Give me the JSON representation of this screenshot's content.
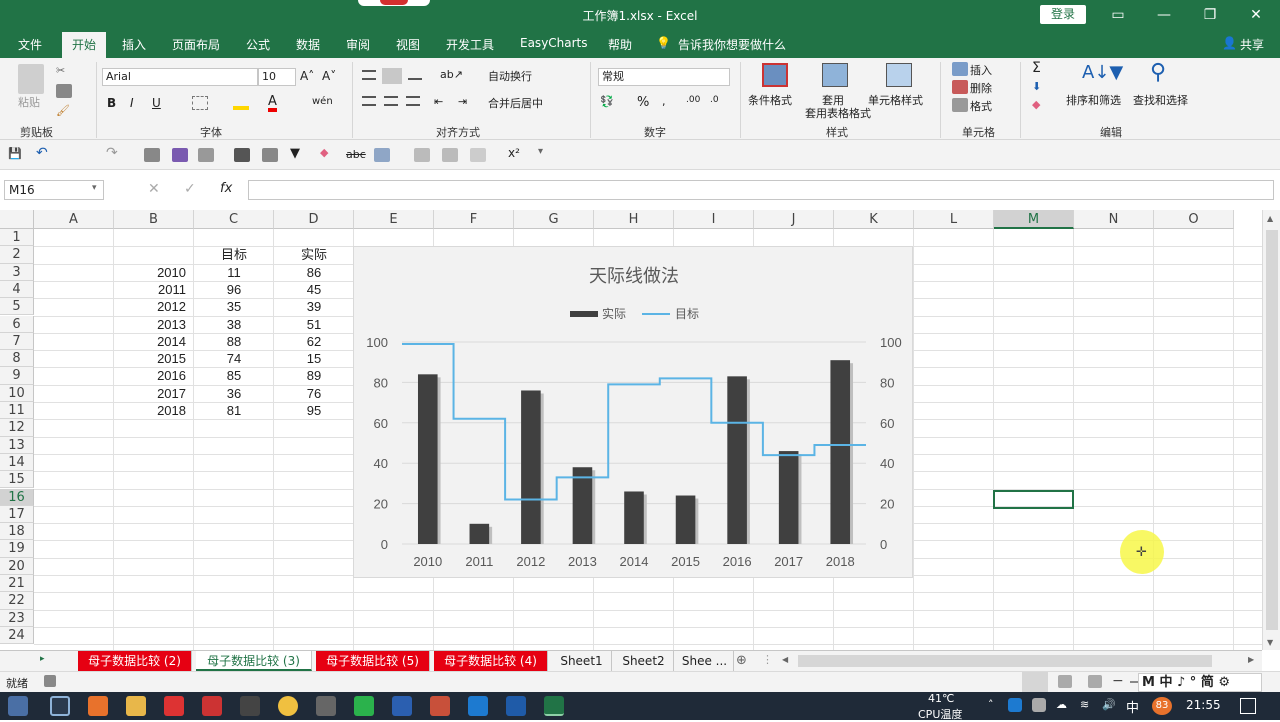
{
  "app": {
    "title": "工作簿1.xlsx  -  Excel",
    "login": "登录",
    "share": "共享"
  },
  "ribbon_tabs": [
    "文件",
    "开始",
    "插入",
    "页面布局",
    "公式",
    "数据",
    "审阅",
    "视图",
    "开发工具",
    "EasyCharts",
    "帮助",
    "告诉我你想要做什么"
  ],
  "ribbon": {
    "paste": "粘贴",
    "font_name": "Arial",
    "font_size": "10",
    "wrap": "自动换行",
    "merge": "合并后居中",
    "number_format": "常规",
    "cond_format": "条件格式",
    "table_format": "套用表格格式",
    "cell_style": "单元格样式",
    "insert": "插入",
    "delete": "删除",
    "format": "格式",
    "sort_filter": "排序和筛选",
    "find_select": "查找和选择",
    "groups": [
      "剪贴板",
      "字体",
      "对齐方式",
      "数字",
      "样式",
      "单元格",
      "编辑"
    ]
  },
  "formula_bar": {
    "name_box": "M16",
    "fx": "fx",
    "formula": ""
  },
  "columns": [
    "A",
    "B",
    "C",
    "D",
    "E",
    "F",
    "G",
    "H",
    "I",
    "J",
    "K",
    "L",
    "M",
    "N",
    "O"
  ],
  "selected_column": "M",
  "rows": [
    "1",
    "2",
    "3",
    "4",
    "5",
    "6",
    "7",
    "8",
    "9",
    "10",
    "11",
    "12",
    "13",
    "14",
    "15",
    "16",
    "17",
    "18",
    "19",
    "20",
    "21",
    "22",
    "23",
    "24"
  ],
  "selected_row": "16",
  "table": {
    "headers": [
      "目标",
      "实际"
    ],
    "rows": [
      [
        "2010",
        "11",
        "86"
      ],
      [
        "2011",
        "96",
        "45"
      ],
      [
        "2012",
        "35",
        "39"
      ],
      [
        "2013",
        "38",
        "51"
      ],
      [
        "2014",
        "88",
        "62"
      ],
      [
        "2015",
        "74",
        "15"
      ],
      [
        "2016",
        "85",
        "89"
      ],
      [
        "2017",
        "36",
        "76"
      ],
      [
        "2018",
        "81",
        "95"
      ]
    ]
  },
  "chart_data": {
    "type": "bar",
    "title": "天际线做法",
    "categories": [
      "2010",
      "2011",
      "2012",
      "2013",
      "2014",
      "2015",
      "2016",
      "2017",
      "2018"
    ],
    "series": [
      {
        "name": "实际",
        "type": "bar",
        "values": [
          84,
          10,
          76,
          38,
          26,
          24,
          83,
          46,
          91
        ],
        "color": "#404040"
      },
      {
        "name": "目标",
        "type": "step-line",
        "values": [
          99,
          62,
          22,
          33,
          79,
          82,
          60,
          44,
          49
        ],
        "color": "#5bb4e5"
      }
    ],
    "ylim": [
      0,
      100
    ],
    "yticks": [
      "0",
      "20",
      "40",
      "60",
      "80",
      "100"
    ],
    "legend": "top",
    "grid": true
  },
  "sheet_tabs": [
    "母子数据比较 (2)",
    "母子数据比较 (3)",
    "母子数据比较 (5)",
    "母子数据比较 (4)",
    "Sheet1",
    "Sheet2",
    "Shee ..."
  ],
  "status": {
    "ready": "就绪"
  },
  "taskbar": {
    "temp": "41℃",
    "cpu": "CPU温度",
    "ime": "中",
    "badge": "83",
    "time": "21:55"
  }
}
